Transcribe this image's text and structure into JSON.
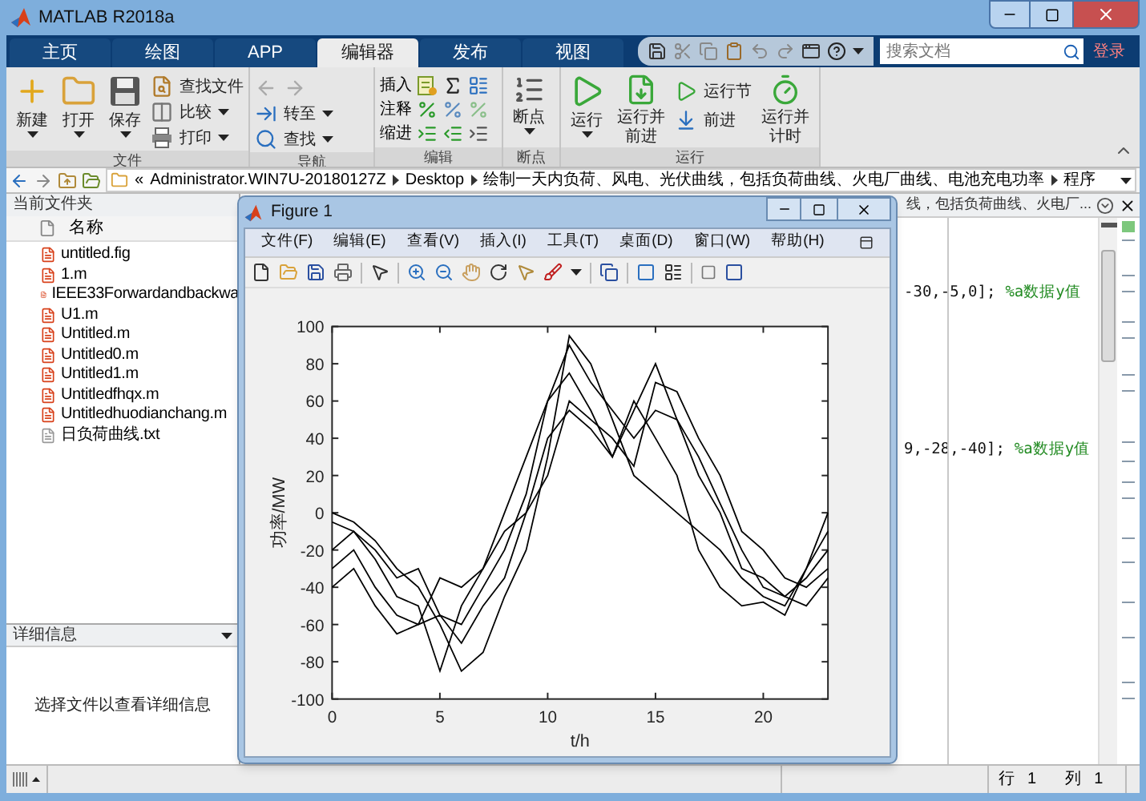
{
  "window": {
    "title": "MATLAB R2018a"
  },
  "tabs": [
    {
      "label": "主页",
      "selected": false
    },
    {
      "label": "绘图",
      "selected": false
    },
    {
      "label": "APP",
      "selected": false
    },
    {
      "label": "编辑器",
      "selected": true
    },
    {
      "label": "发布",
      "selected": false
    },
    {
      "label": "视图",
      "selected": false
    }
  ],
  "search": {
    "placeholder": "搜索文档"
  },
  "login": "登录",
  "ribbon": {
    "file": {
      "label": "文件",
      "new": "新建",
      "open": "打开",
      "save": "保存",
      "find_files": "查找文件",
      "compare": "比较",
      "print": "打印"
    },
    "navigate": {
      "label": "导航",
      "goto": "转至",
      "find": "查找"
    },
    "edit": {
      "label": "编辑",
      "insert": "插入",
      "comment": "注释",
      "indent": "缩进"
    },
    "breakpoints": {
      "label": "断点",
      "breakpoints": "断点"
    },
    "run": {
      "label": "运行",
      "run": "运行",
      "run_advance": "运行并前进",
      "run_section": "运行节",
      "advance": "前进",
      "run_time": "运行并计时"
    }
  },
  "address": {
    "prefix": "«",
    "path": [
      "Administrator.WIN7U-20180127Z",
      "Desktop",
      "绘制一天内负荷、风电、光伏曲线，包括负荷曲线、火电厂曲线、电池充电功率",
      "程序"
    ]
  },
  "current_folder": {
    "title": "当前文件夹",
    "column": "名称",
    "files": [
      {
        "name": "untitled.fig",
        "kind": "matlab"
      },
      {
        "name": "1.m",
        "kind": "matlab"
      },
      {
        "name": "IEEE33Forwardandbackwa",
        "kind": "matlab"
      },
      {
        "name": "U1.m",
        "kind": "matlab"
      },
      {
        "name": "Untitled.m",
        "kind": "matlab"
      },
      {
        "name": "Untitled0.m",
        "kind": "matlab"
      },
      {
        "name": "Untitled1.m",
        "kind": "matlab"
      },
      {
        "name": "Untitledfhqx.m",
        "kind": "matlab"
      },
      {
        "name": "Untitledhuodianchang.m",
        "kind": "matlab"
      },
      {
        "name": "日负荷曲线.txt",
        "kind": "text"
      }
    ]
  },
  "details": {
    "title": "详细信息",
    "hint": "选择文件以查看详细信息"
  },
  "editor": {
    "tab_title": "线，包括负荷曲线、火电厂...",
    "lines": [
      {
        "code": "-30,-5,0];",
        "comment": "%a数据y值"
      },
      {
        "code": "9,-28,-40];",
        "comment": "%a数据y值"
      }
    ]
  },
  "figure": {
    "title": "Figure 1",
    "menu": [
      "文件(F)",
      "编辑(E)",
      "查看(V)",
      "插入(I)",
      "工具(T)",
      "桌面(D)",
      "窗口(W)",
      "帮助(H)"
    ],
    "chart_data": {
      "type": "line",
      "xlabel": "t/h",
      "ylabel": "功率/MW",
      "xlim": [
        0,
        23
      ],
      "ylim": [
        -100,
        100
      ],
      "xticks": [
        0,
        5,
        10,
        15,
        20
      ],
      "yticks": [
        -100,
        -80,
        -60,
        -40,
        -20,
        0,
        20,
        40,
        60,
        80,
        100
      ],
      "x": [
        0,
        1,
        2,
        3,
        4,
        5,
        6,
        7,
        8,
        9,
        10,
        11,
        12,
        13,
        14,
        15,
        16,
        17,
        18,
        19,
        20,
        21,
        22,
        23
      ],
      "series": [
        {
          "color": "#000000",
          "values": [
            0,
            -5,
            -15,
            -30,
            -40,
            -60,
            -85,
            -75,
            -45,
            -20,
            30,
            95,
            80,
            50,
            20,
            10,
            0,
            -10,
            -20,
            -35,
            -45,
            -50,
            -30,
            0
          ]
        },
        {
          "color": "#000000",
          "values": [
            -5,
            -10,
            -20,
            -35,
            -30,
            -55,
            -60,
            -40,
            -20,
            10,
            60,
            75,
            55,
            30,
            60,
            40,
            20,
            -20,
            -40,
            -50,
            -48,
            -55,
            -30,
            -10
          ]
        },
        {
          "color": "#000000",
          "values": [
            -20,
            -10,
            -25,
            -45,
            -50,
            -85,
            -50,
            -30,
            0,
            30,
            60,
            90,
            70,
            55,
            40,
            55,
            50,
            30,
            5,
            -20,
            -40,
            -45,
            -35,
            -20
          ]
        },
        {
          "color": "#000000",
          "values": [
            -30,
            -20,
            -40,
            -55,
            -60,
            -55,
            -70,
            -50,
            -35,
            0,
            20,
            60,
            50,
            40,
            25,
            70,
            65,
            40,
            20,
            -10,
            -20,
            -35,
            -40,
            -30
          ]
        },
        {
          "color": "#000000",
          "values": [
            -40,
            -30,
            -50,
            -65,
            -60,
            -35,
            -40,
            -30,
            -10,
            0,
            40,
            55,
            45,
            30,
            55,
            80,
            50,
            20,
            0,
            -30,
            -35,
            -45,
            -50,
            -35
          ]
        }
      ]
    }
  },
  "status": [
    {
      "label": "行",
      "value": "1"
    },
    {
      "label": "列",
      "value": "1"
    }
  ]
}
